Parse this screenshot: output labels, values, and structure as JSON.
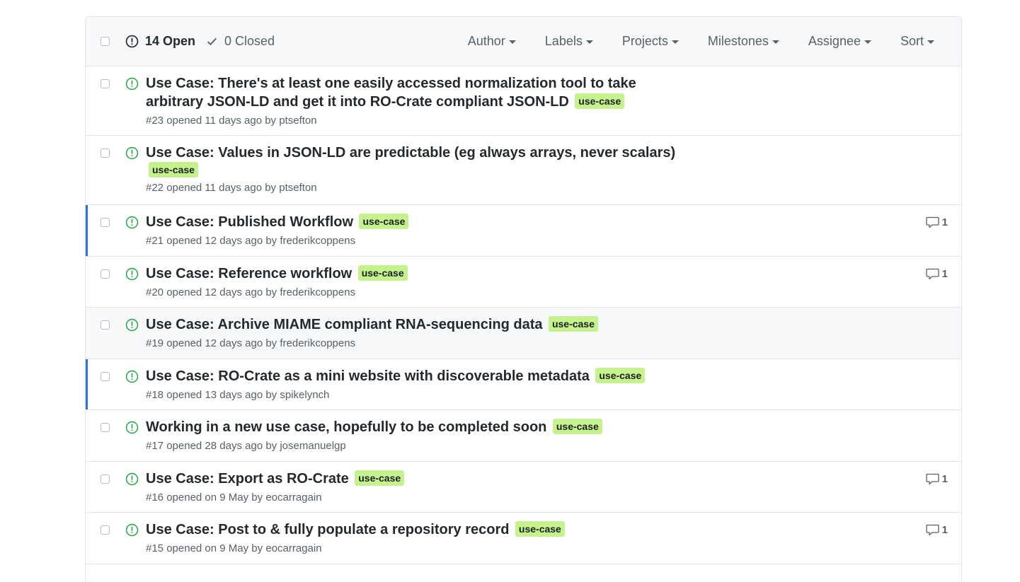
{
  "header": {
    "open_count": "14",
    "open_label": "Open",
    "closed_count": "0",
    "closed_label": "Closed",
    "filters": [
      "Author",
      "Labels",
      "Projects",
      "Milestones",
      "Assignee",
      "Sort"
    ]
  },
  "colors": {
    "label_bg": "#c5f28c",
    "open_icon": "#28a745",
    "unread_bar": "#2f6fd6"
  },
  "issues": [
    {
      "title": "Use Case: There's at least one easily accessed normalization tool to take arbitrary JSON-LD and get it into RO-Crate compliant JSON-LD",
      "label": "use-case",
      "number": "#23",
      "opened": "opened 11 days ago by",
      "author": "ptsefton",
      "comments": ""
    },
    {
      "title": "Use Case: Values in JSON-LD are predictable (eg always arrays, never scalars)",
      "label": "use-case",
      "number": "#22",
      "opened": "opened 11 days ago by",
      "author": "ptsefton",
      "comments": ""
    },
    {
      "title": "Use Case: Published Workflow",
      "label": "use-case",
      "number": "#21",
      "opened": "opened 12 days ago by",
      "author": "frederikcoppens",
      "comments": "1"
    },
    {
      "title": "Use Case: Reference workflow",
      "label": "use-case",
      "number": "#20",
      "opened": "opened 12 days ago by",
      "author": "frederikcoppens",
      "comments": "1"
    },
    {
      "title": "Use Case: Archive MIAME compliant RNA-sequencing data",
      "label": "use-case",
      "number": "#19",
      "opened": "opened 12 days ago by",
      "author": "frederikcoppens",
      "comments": ""
    },
    {
      "title": "Use Case: RO-Crate as a mini website with discoverable metadata",
      "label": "use-case",
      "number": "#18",
      "opened": "opened 13 days ago by",
      "author": "spikelynch",
      "comments": ""
    },
    {
      "title": "Working in a new use case, hopefully to be completed soon",
      "label": "use-case",
      "number": "#17",
      "opened": "opened 28 days ago by",
      "author": "josemanuelgp",
      "comments": ""
    },
    {
      "title": "Use Case: Export as RO-Crate",
      "label": "use-case",
      "number": "#16",
      "opened": "opened on 9 May by",
      "author": "eocarragain",
      "comments": "1"
    },
    {
      "title": "Use Case: Post to & fully populate a repository record",
      "label": "use-case",
      "number": "#15",
      "opened": "opened on 9 May by",
      "author": "eocarragain",
      "comments": "1"
    }
  ]
}
